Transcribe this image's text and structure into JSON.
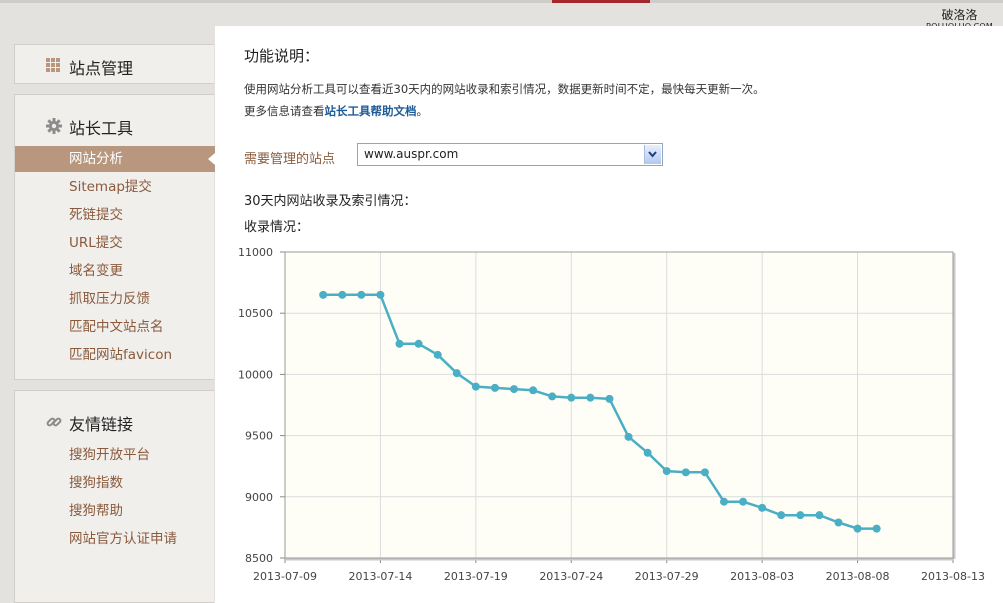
{
  "watermark": {
    "line1": "破洛洛",
    "line2": "POLUOLUO.COM"
  },
  "sidebar": {
    "site_manage": {
      "label": "站点管理",
      "icon": "grid-icon"
    },
    "webmaster_tools": {
      "label": "站长工具",
      "icon": "gear-icon",
      "items": [
        {
          "label": "网站分析",
          "active": true
        },
        {
          "label": "Sitemap提交"
        },
        {
          "label": "死链提交"
        },
        {
          "label": "URL提交"
        },
        {
          "label": "域名变更"
        },
        {
          "label": "抓取压力反馈"
        },
        {
          "label": "匹配中文站点名"
        },
        {
          "label": "匹配网站favicon"
        }
      ]
    },
    "friend_links": {
      "label": "友情链接",
      "icon": "link-icon",
      "items": [
        {
          "label": "搜狗开放平台"
        },
        {
          "label": "搜狗指数"
        },
        {
          "label": "搜狗帮助"
        },
        {
          "label": "网站官方认证申请"
        }
      ]
    }
  },
  "main": {
    "title": "功能说明：",
    "desc1": "使用网站分析工具可以查看近30天内的网站收录和索引情况，数据更新时间不定，最快每天更新一次。",
    "desc2_prefix": "更多信息请查看",
    "desc2_link": "站长工具帮助文档",
    "desc2_suffix": "。",
    "site_label": "需要管理的站点",
    "site_value": "www.auspr.com",
    "section_title": "30天内网站收录及索引情况：",
    "chart_title": "收录情况："
  },
  "colors": {
    "accent": "#a3272b",
    "active_nav": "#b8977e",
    "line": "#4aaec4",
    "plot_bg": "#fffef6"
  },
  "chart_data": {
    "type": "line",
    "title": "收录情况：",
    "xlabel": "",
    "ylabel": "",
    "x_ticks": [
      "2013-07-09",
      "2013-07-14",
      "2013-07-19",
      "2013-07-24",
      "2013-07-29",
      "2013-08-03",
      "2013-08-08",
      "2013-08-13"
    ],
    "y_ticks": [
      8500,
      9000,
      9500,
      10000,
      10500,
      11000
    ],
    "ylim": [
      8500,
      11000
    ],
    "xlim": [
      "2013-07-09",
      "2013-08-13"
    ],
    "grid": true,
    "series": [
      {
        "x": [
          "2013-07-11",
          "2013-07-12",
          "2013-07-13",
          "2013-07-14",
          "2013-07-15",
          "2013-07-16",
          "2013-07-17",
          "2013-07-18",
          "2013-07-19",
          "2013-07-20",
          "2013-07-21",
          "2013-07-22",
          "2013-07-23",
          "2013-07-24",
          "2013-07-25",
          "2013-07-26",
          "2013-07-27",
          "2013-07-28",
          "2013-07-29",
          "2013-07-30",
          "2013-07-31",
          "2013-08-01",
          "2013-08-02",
          "2013-08-03",
          "2013-08-04",
          "2013-08-05",
          "2013-08-06",
          "2013-08-07",
          "2013-08-08",
          "2013-08-09"
        ],
        "values": [
          10650,
          10650,
          10650,
          10650,
          10250,
          10250,
          10160,
          10010,
          9900,
          9890,
          9880,
          9870,
          9820,
          9810,
          9810,
          9800,
          9490,
          9360,
          9210,
          9200,
          9200,
          8960,
          8960,
          8910,
          8850,
          8850,
          8850,
          8790,
          8740,
          8740
        ]
      }
    ]
  }
}
